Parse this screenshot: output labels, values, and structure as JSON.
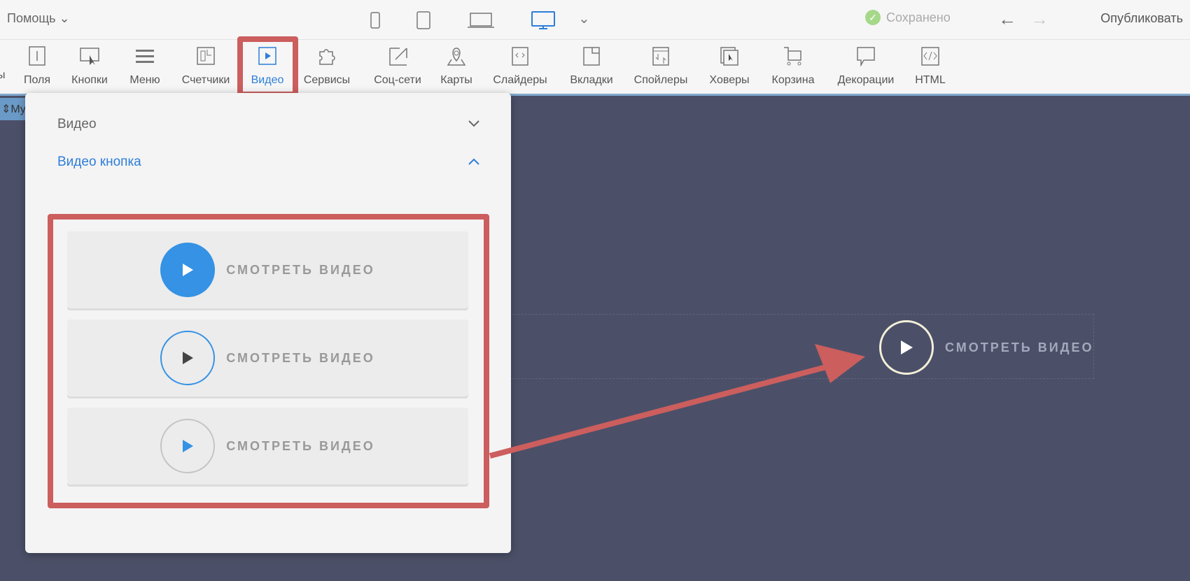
{
  "topbar": {
    "help_label": "Помощь",
    "saved_label": "Сохранено",
    "publish_label": "Опубликовать"
  },
  "toolbar": {
    "partial_label": "ы",
    "items": [
      {
        "label": "Поля",
        "icon": "field-icon"
      },
      {
        "label": "Кнопки",
        "icon": "button-icon"
      },
      {
        "label": "Меню",
        "icon": "menu-icon"
      },
      {
        "label": "Счетчики",
        "icon": "counter-icon"
      },
      {
        "label": "Видео",
        "icon": "video-icon"
      },
      {
        "label": "Сервисы",
        "icon": "puzzle-icon"
      },
      {
        "label": "Соц-сети",
        "icon": "share-icon"
      },
      {
        "label": "Карты",
        "icon": "map-pin-icon"
      },
      {
        "label": "Слайдеры",
        "icon": "slider-icon"
      },
      {
        "label": "Вкладки",
        "icon": "tabs-icon"
      },
      {
        "label": "Спойлеры",
        "icon": "spoiler-icon"
      },
      {
        "label": "Ховеры",
        "icon": "hover-icon"
      },
      {
        "label": "Корзина",
        "icon": "cart-icon"
      },
      {
        "label": "Декорации",
        "icon": "speech-bubble-icon"
      },
      {
        "label": "HTML",
        "icon": "code-icon"
      }
    ]
  },
  "canvas": {
    "tab_label": "My",
    "video_button_text": "СМОТРЕТЬ ВИДЕО"
  },
  "popup": {
    "section1": "Видео",
    "section2": "Видео кнопка",
    "cards": [
      {
        "text": "СМОТРЕТЬ ВИДЕО"
      },
      {
        "text": "СМОТРЕТЬ ВИДЕО"
      },
      {
        "text": "СМОТРЕТЬ ВИДЕО"
      }
    ]
  },
  "colors": {
    "accent": "#2d7ed8",
    "highlight": "#cc5e5e",
    "canvas": "#4b5068"
  }
}
